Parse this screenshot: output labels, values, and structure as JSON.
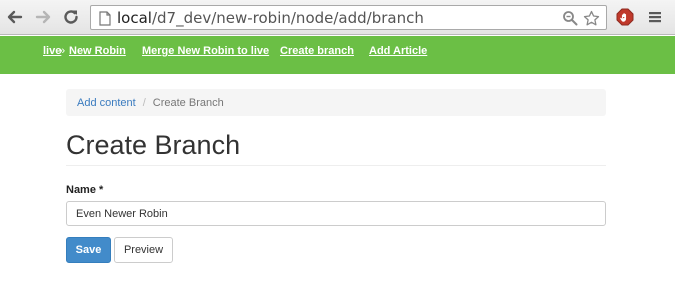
{
  "browser": {
    "url_host": "local",
    "url_path": "/d7_dev/new-robin/node/add/branch"
  },
  "adminbar": {
    "site_link": "live",
    "site_sep": "»",
    "site_current": "New Robin",
    "links": [
      "Merge New Robin to live",
      "Create branch",
      "Add Article"
    ]
  },
  "breadcrumb": {
    "link": "Add content",
    "sep": "/",
    "current": "Create Branch"
  },
  "page": {
    "title": "Create Branch"
  },
  "form": {
    "name_label": "Name *",
    "name_value": "Even Newer Robin",
    "save_label": "Save",
    "preview_label": "Preview"
  },
  "colors": {
    "adminbar": "#6bbf45",
    "primary_button": "#428bca",
    "link": "#3a7bbf"
  }
}
